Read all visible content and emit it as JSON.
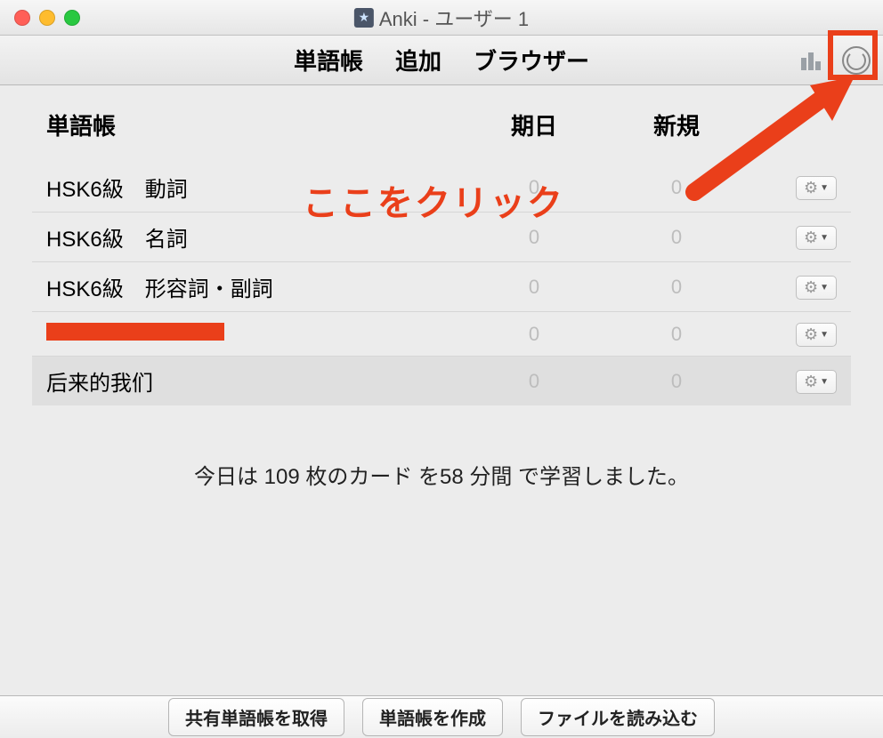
{
  "window": {
    "title": "Anki - ユーザー 1"
  },
  "toolbar": {
    "decks": "単語帳",
    "add": "追加",
    "browser": "ブラウザー"
  },
  "headers": {
    "deck": "単語帳",
    "due": "期日",
    "new": "新規"
  },
  "decks": [
    {
      "name": "HSK6級　動詞",
      "due": "0",
      "new": "0",
      "redacted": false,
      "highlighted": false
    },
    {
      "name": "HSK6級　名詞",
      "due": "0",
      "new": "0",
      "redacted": false,
      "highlighted": false
    },
    {
      "name": "HSK6級　形容詞・副詞",
      "due": "0",
      "new": "0",
      "redacted": false,
      "highlighted": false
    },
    {
      "name": "",
      "due": "0",
      "new": "0",
      "redacted": true,
      "highlighted": false
    },
    {
      "name": "后来的我们",
      "due": "0",
      "new": "0",
      "redacted": false,
      "highlighted": true
    }
  ],
  "summary": "今日は 109 枚のカード を58 分間 で学習しました。",
  "bottom": {
    "get_shared": "共有単語帳を取得",
    "create_deck": "単語帳を作成",
    "import_file": "ファイルを読み込む"
  },
  "annotation": {
    "text": "ここをクリック"
  }
}
